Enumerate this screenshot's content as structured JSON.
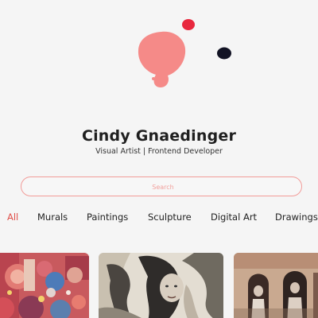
{
  "profile": {
    "name": "Cindy Gnaedinger",
    "tagline": "Visual Artist | Frontend Developer"
  },
  "search": {
    "placeholder": "Search",
    "accent_color": "#f29c99"
  },
  "filters": {
    "active": "All",
    "tabs": [
      {
        "label": "All"
      },
      {
        "label": "Murals"
      },
      {
        "label": "Paintings"
      },
      {
        "label": "Sculpture"
      },
      {
        "label": "Digital Art"
      },
      {
        "label": "Drawings"
      }
    ]
  },
  "colors": {
    "active_tab": "#e0504a",
    "blob_pink": "#f58a88",
    "blob_red": "#e8283e",
    "blob_dark": "#121324"
  },
  "gallery": {
    "items": [
      {
        "type": "colorful-mural-artwork"
      },
      {
        "type": "monochrome-figure-painting"
      },
      {
        "type": "arched-figures-painting"
      }
    ]
  }
}
